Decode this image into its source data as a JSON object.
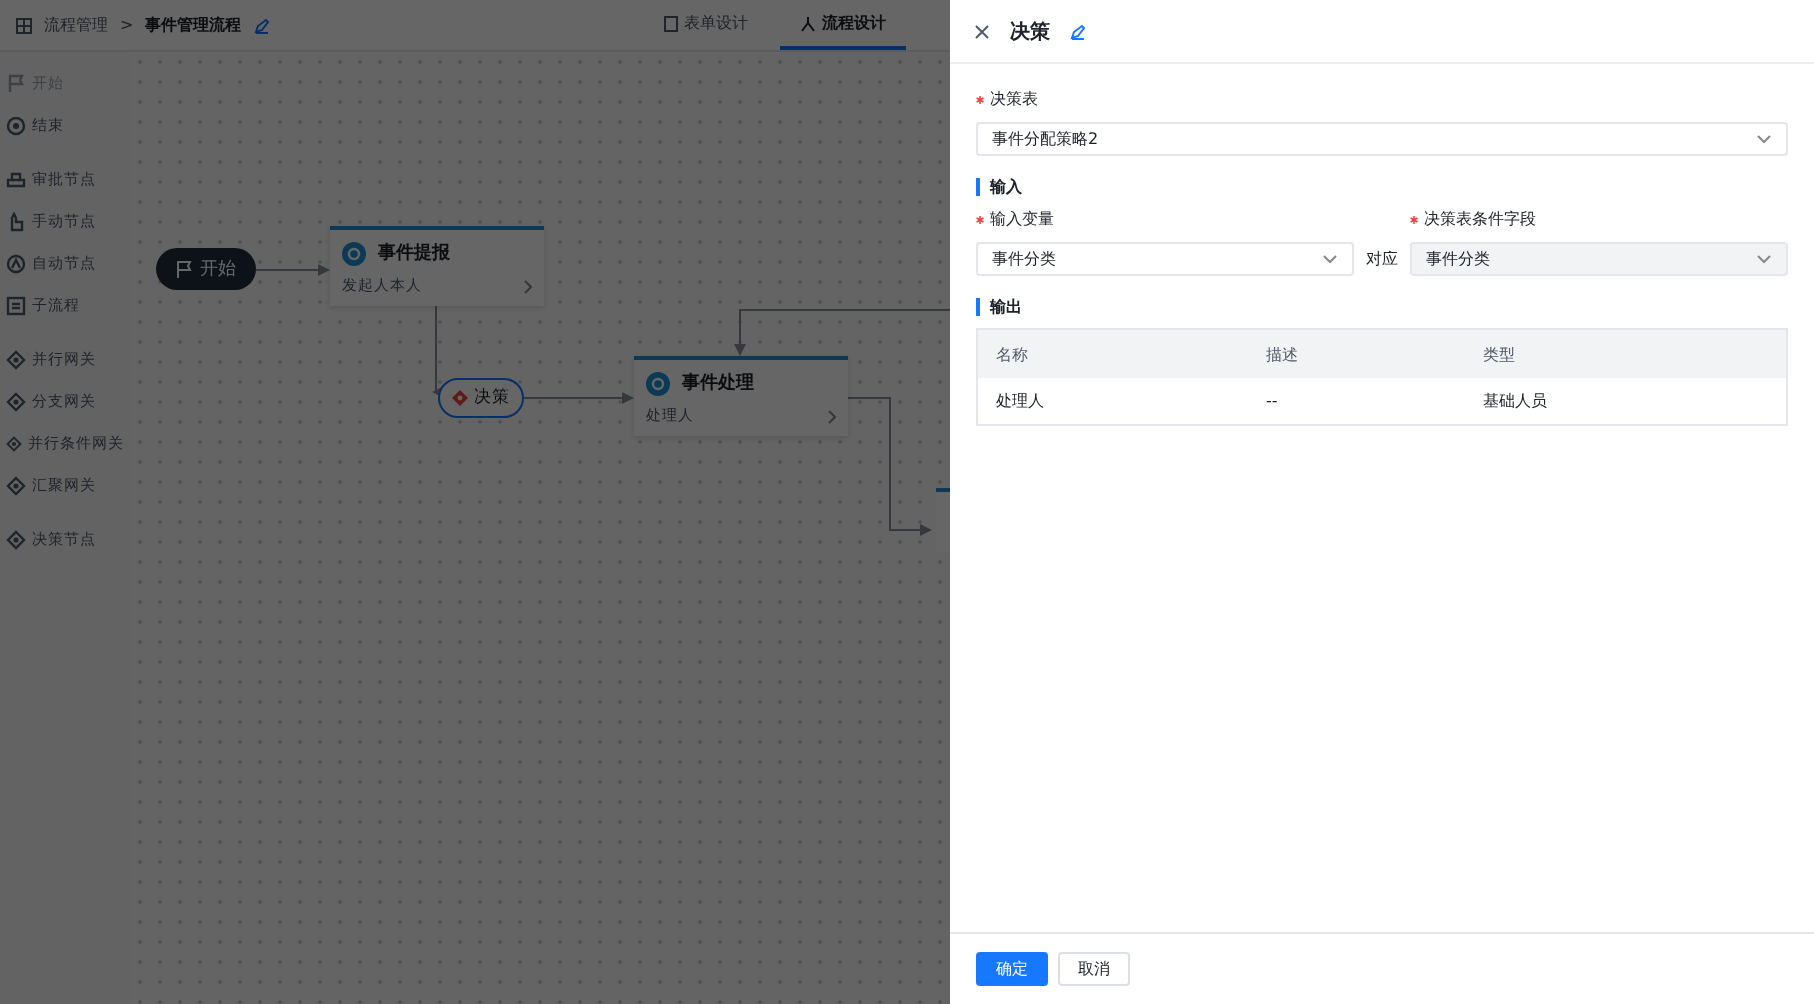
{
  "breadcrumb": {
    "parent": "流程管理",
    "separator": ">",
    "current": "事件管理流程"
  },
  "tabs": [
    {
      "label": "表单设计",
      "selected": false
    },
    {
      "label": "流程设计",
      "selected": true
    }
  ],
  "palette": [
    {
      "items": [
        {
          "kind": "start",
          "label": "开始",
          "disabled": true
        },
        {
          "kind": "end",
          "label": "结束",
          "disabled": false
        }
      ]
    },
    {
      "items": [
        {
          "kind": "approval",
          "label": "审批节点",
          "disabled": false
        },
        {
          "kind": "manual",
          "label": "手动节点",
          "disabled": false
        },
        {
          "kind": "auto",
          "label": "自动节点",
          "disabled": false
        },
        {
          "kind": "subprocess",
          "label": "子流程",
          "disabled": false
        }
      ]
    },
    {
      "items": [
        {
          "kind": "gateway",
          "label": "并行网关",
          "disabled": false
        },
        {
          "kind": "gateway",
          "label": "分支网关",
          "disabled": false
        },
        {
          "kind": "gateway",
          "label": "并行条件网关",
          "disabled": false
        },
        {
          "kind": "gateway",
          "label": "汇聚网关",
          "disabled": false
        }
      ]
    },
    {
      "items": [
        {
          "kind": "gateway",
          "label": "决策节点",
          "disabled": false
        }
      ]
    }
  ],
  "canvas": {
    "nodes": [
      {
        "kind": "start",
        "label": "开始"
      },
      {
        "kind": "task",
        "title": "事件提报",
        "subtitle": "发起人本人"
      },
      {
        "kind": "decision",
        "label": "决策",
        "selected": true
      },
      {
        "kind": "task",
        "title": "事件处理",
        "subtitle": "处理人"
      }
    ]
  },
  "drawer": {
    "title": "决策",
    "decision_table": {
      "label": "决策表",
      "required": true,
      "value": "事件分配策略2",
      "disabled": false
    },
    "input_section": "输入",
    "input_variable": {
      "label": "输入变量",
      "required": true,
      "value": "事件分类",
      "disabled": false
    },
    "mapping_word": "对应",
    "condition_field": {
      "label": "决策表条件字段",
      "required": true,
      "value": "事件分类",
      "disabled": true
    },
    "output_section": "输出",
    "output_table": {
      "columns": [
        "名称",
        "描述",
        "类型"
      ],
      "rows": [
        [
          "处理人",
          "--",
          "基础人员"
        ]
      ]
    },
    "buttons": [
      {
        "kind": "primary",
        "label": "确定"
      },
      {
        "kind": "default",
        "label": "取消"
      }
    ]
  }
}
